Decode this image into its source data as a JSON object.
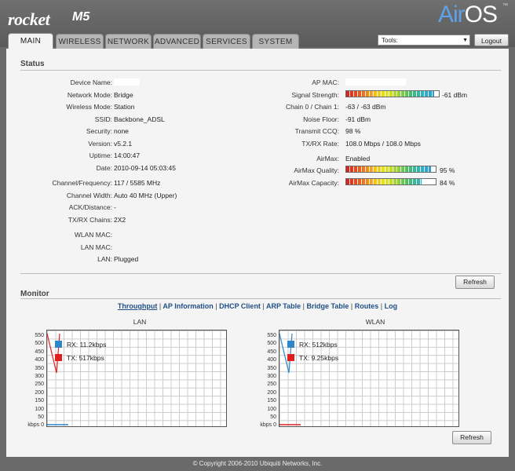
{
  "brand": {
    "product": "rocket",
    "model": "M5",
    "os_prefix": "Air",
    "os_suffix": "OS",
    "trademark": "™"
  },
  "tabs": [
    {
      "label": "MAIN"
    },
    {
      "label": "WIRELESS"
    },
    {
      "label": "NETWORK"
    },
    {
      "label": "ADVANCED"
    },
    {
      "label": "SERVICES"
    },
    {
      "label": "SYSTEM"
    }
  ],
  "toolbar": {
    "tools_value": "Tools:",
    "logout_label": "Logout"
  },
  "status": {
    "title": "Status",
    "left": [
      {
        "label": "Device Name:",
        "value": ""
      },
      {
        "label": "Network Mode:",
        "value": "Bridge"
      },
      {
        "label": "Wireless Mode:",
        "value": "Station"
      },
      {
        "label": "SSID:",
        "value": "Backbone_ADSL"
      },
      {
        "label": "Security:",
        "value": "none"
      },
      {
        "label": "Version:",
        "value": "v5.2.1"
      },
      {
        "label": "Uptime:",
        "value": "14:00:47"
      },
      {
        "label": "Date:",
        "value": "2010-09-14 05:03:45"
      },
      {
        "label": "Channel/Frequency:",
        "value": "117 / 5585 MHz"
      },
      {
        "label": "Channel Width:",
        "value": "Auto 40 MHz (Upper)"
      },
      {
        "label": "ACK/Distance:",
        "value": "-"
      },
      {
        "label": "TX/RX Chains:",
        "value": "2X2"
      },
      {
        "label": "WLAN MAC:",
        "value": ""
      },
      {
        "label": "LAN MAC:",
        "value": ""
      },
      {
        "label": "LAN:",
        "value": "Plugged"
      }
    ],
    "right": {
      "ap_mac": {
        "label": "AP MAC:",
        "value": ""
      },
      "signal": {
        "label": "Signal Strength:",
        "value": "-61 dBm",
        "level": 0.95
      },
      "chain": {
        "label": "Chain 0 / Chain 1:",
        "value": "-63 / -63 dBm"
      },
      "noise": {
        "label": "Noise Floor:",
        "value": "-91 dBm"
      },
      "ccq": {
        "label": "Transmit CCQ:",
        "value": "98 %"
      },
      "rate": {
        "label": "TX/RX Rate:",
        "value": "108.0 Mbps / 108.0 Mbps"
      },
      "airmax": {
        "label": "AirMax:",
        "value": "Enabled"
      },
      "quality": {
        "label": "AirMax Quality:",
        "value": "95 %",
        "level": 0.95
      },
      "capacity": {
        "label": "AirMax Capacity:",
        "value": "84 %",
        "level": 0.84
      }
    },
    "refresh_label": "Refresh"
  },
  "monitor": {
    "title": "Monitor",
    "links": [
      "Throughput",
      "AP Information",
      "DHCP Client",
      "ARP Table",
      "Bridge Table",
      "Routes",
      "Log"
    ],
    "refresh_label": "Refresh"
  },
  "chart_data": [
    {
      "type": "line",
      "title": "LAN",
      "ylim": [
        0,
        550
      ],
      "yticks": [
        "550",
        "500",
        "450",
        "400",
        "350",
        "300",
        "250",
        "200",
        "150",
        "100",
        "50",
        "kbps 0"
      ],
      "series": [
        {
          "name": "RX",
          "label": "RX: 11.2kbps",
          "color": "#2f86c8"
        },
        {
          "name": "TX",
          "label": "TX: 517kbps",
          "color": "#e02020"
        }
      ]
    },
    {
      "type": "line",
      "title": "WLAN",
      "ylim": [
        0,
        550
      ],
      "yticks": [
        "550",
        "500",
        "450",
        "400",
        "350",
        "300",
        "250",
        "200",
        "150",
        "100",
        "50",
        "kbps 0"
      ],
      "series": [
        {
          "name": "RX",
          "label": "RX: 512kbps",
          "color": "#2f86c8"
        },
        {
          "name": "TX",
          "label": "TX: 9.25kbps",
          "color": "#e02020"
        }
      ]
    }
  ],
  "footer": "© Copyright 2006-2010 Ubiquiti Networks, Inc."
}
